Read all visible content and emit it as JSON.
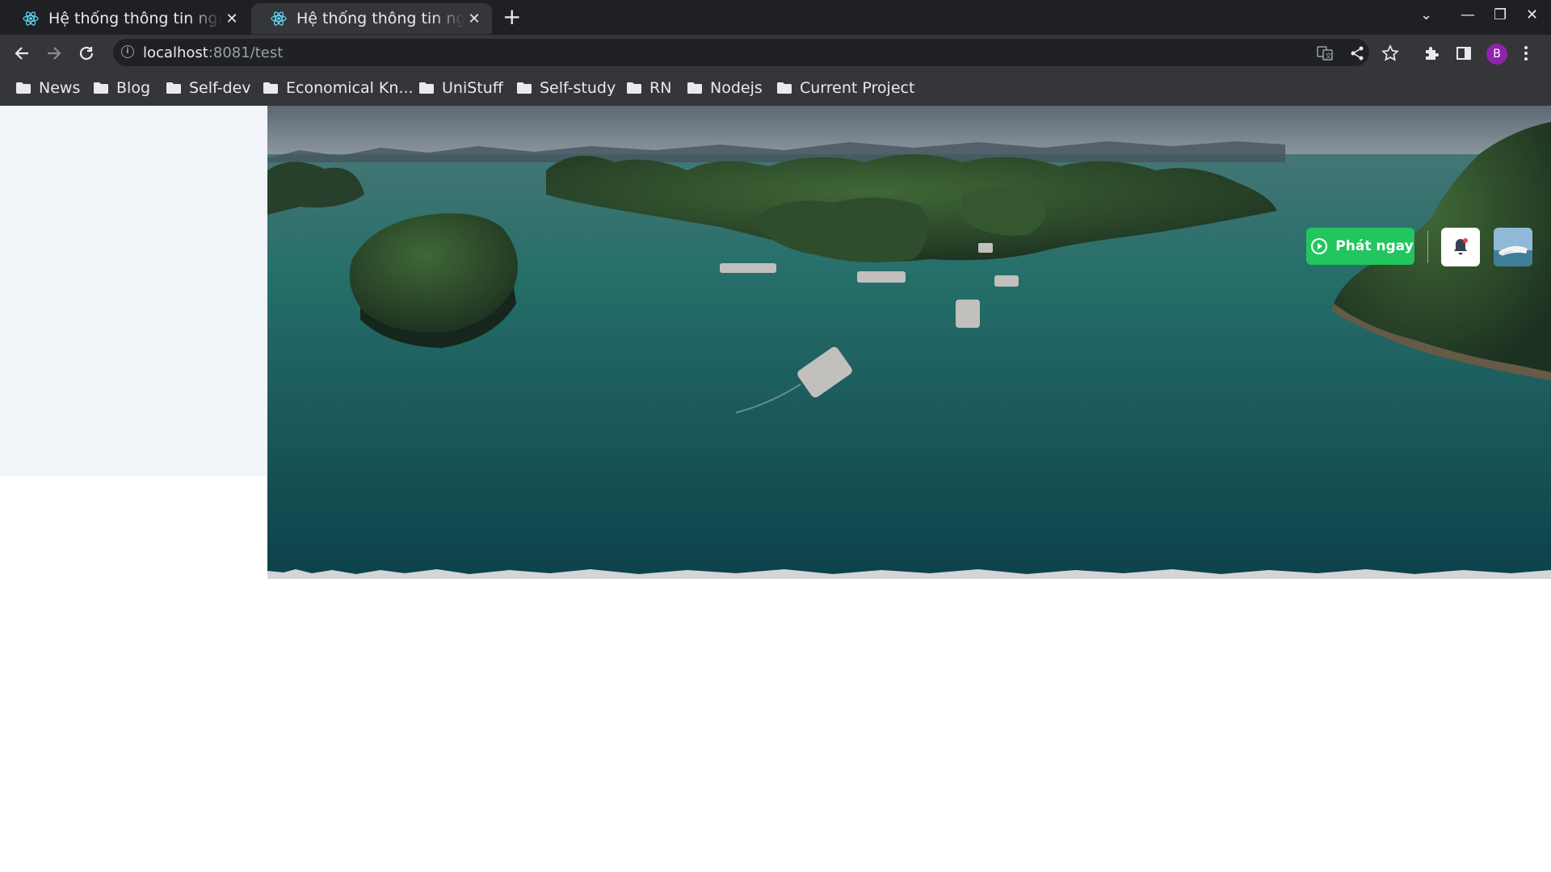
{
  "browser": {
    "tabs": [
      {
        "title": "Hệ thống thông tin nguồn",
        "active": false
      },
      {
        "title": "Hệ thống thông tin nguồn",
        "active": true
      }
    ],
    "new_tab_label": "+",
    "url_host": "localhost",
    "url_path": ":8081/test",
    "profile_initial": "B",
    "bookmarks": [
      "News",
      "Blog",
      "Self-dev",
      "Economical Kn...",
      "UniStuff",
      "Self-study",
      "RN",
      "Nodejs",
      "Current Project"
    ]
  },
  "header": {
    "play_button_label": "Phát ngay",
    "accent_color": "#22c55e",
    "notification_dot_color": "#ef4444"
  }
}
